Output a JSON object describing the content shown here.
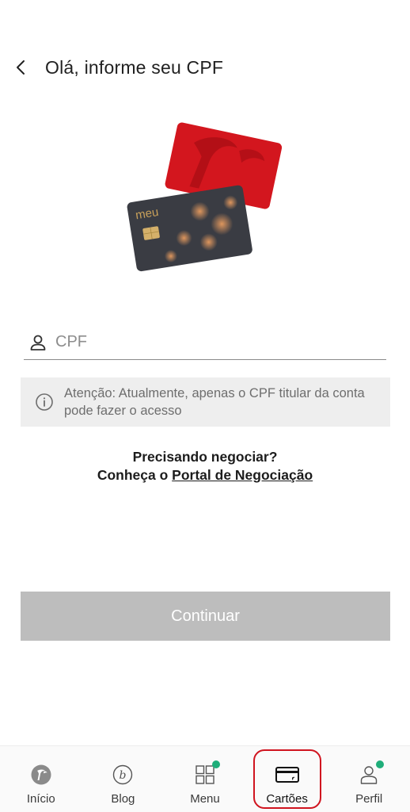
{
  "header": {
    "title": "Olá, informe seu CPF",
    "back_icon": "chevron-left-icon"
  },
  "illustration": {
    "front_card_brand": "meu",
    "colors": {
      "red_card": "#d3161e",
      "dark_card": "#3a3c43"
    }
  },
  "cpf_field": {
    "placeholder": "CPF",
    "value": "",
    "icon": "user-icon"
  },
  "info": {
    "icon": "info-icon",
    "text": "Atenção: Atualmente, apenas o CPF titular da conta pode fazer o acesso"
  },
  "negotiate": {
    "line1": "Precisando negociar?",
    "line2_prefix": "Conheça o ",
    "link_text": "Portal de Negociação"
  },
  "continue_button": {
    "label": "Continuar",
    "enabled": false,
    "color": "#bdbdbd"
  },
  "bottom_nav": {
    "items": [
      {
        "label": "Início",
        "icon": "home-logo-icon",
        "badge": false
      },
      {
        "label": "Blog",
        "icon": "blog-icon",
        "badge": false
      },
      {
        "label": "Menu",
        "icon": "grid-icon",
        "badge": true
      },
      {
        "label": "Cartões",
        "icon": "card-icon",
        "badge": false,
        "highlighted": true
      },
      {
        "label": "Perfil",
        "icon": "profile-icon",
        "badge": true
      }
    ],
    "badge_color": "#1fae7a",
    "highlight_color": "#d0141f"
  }
}
